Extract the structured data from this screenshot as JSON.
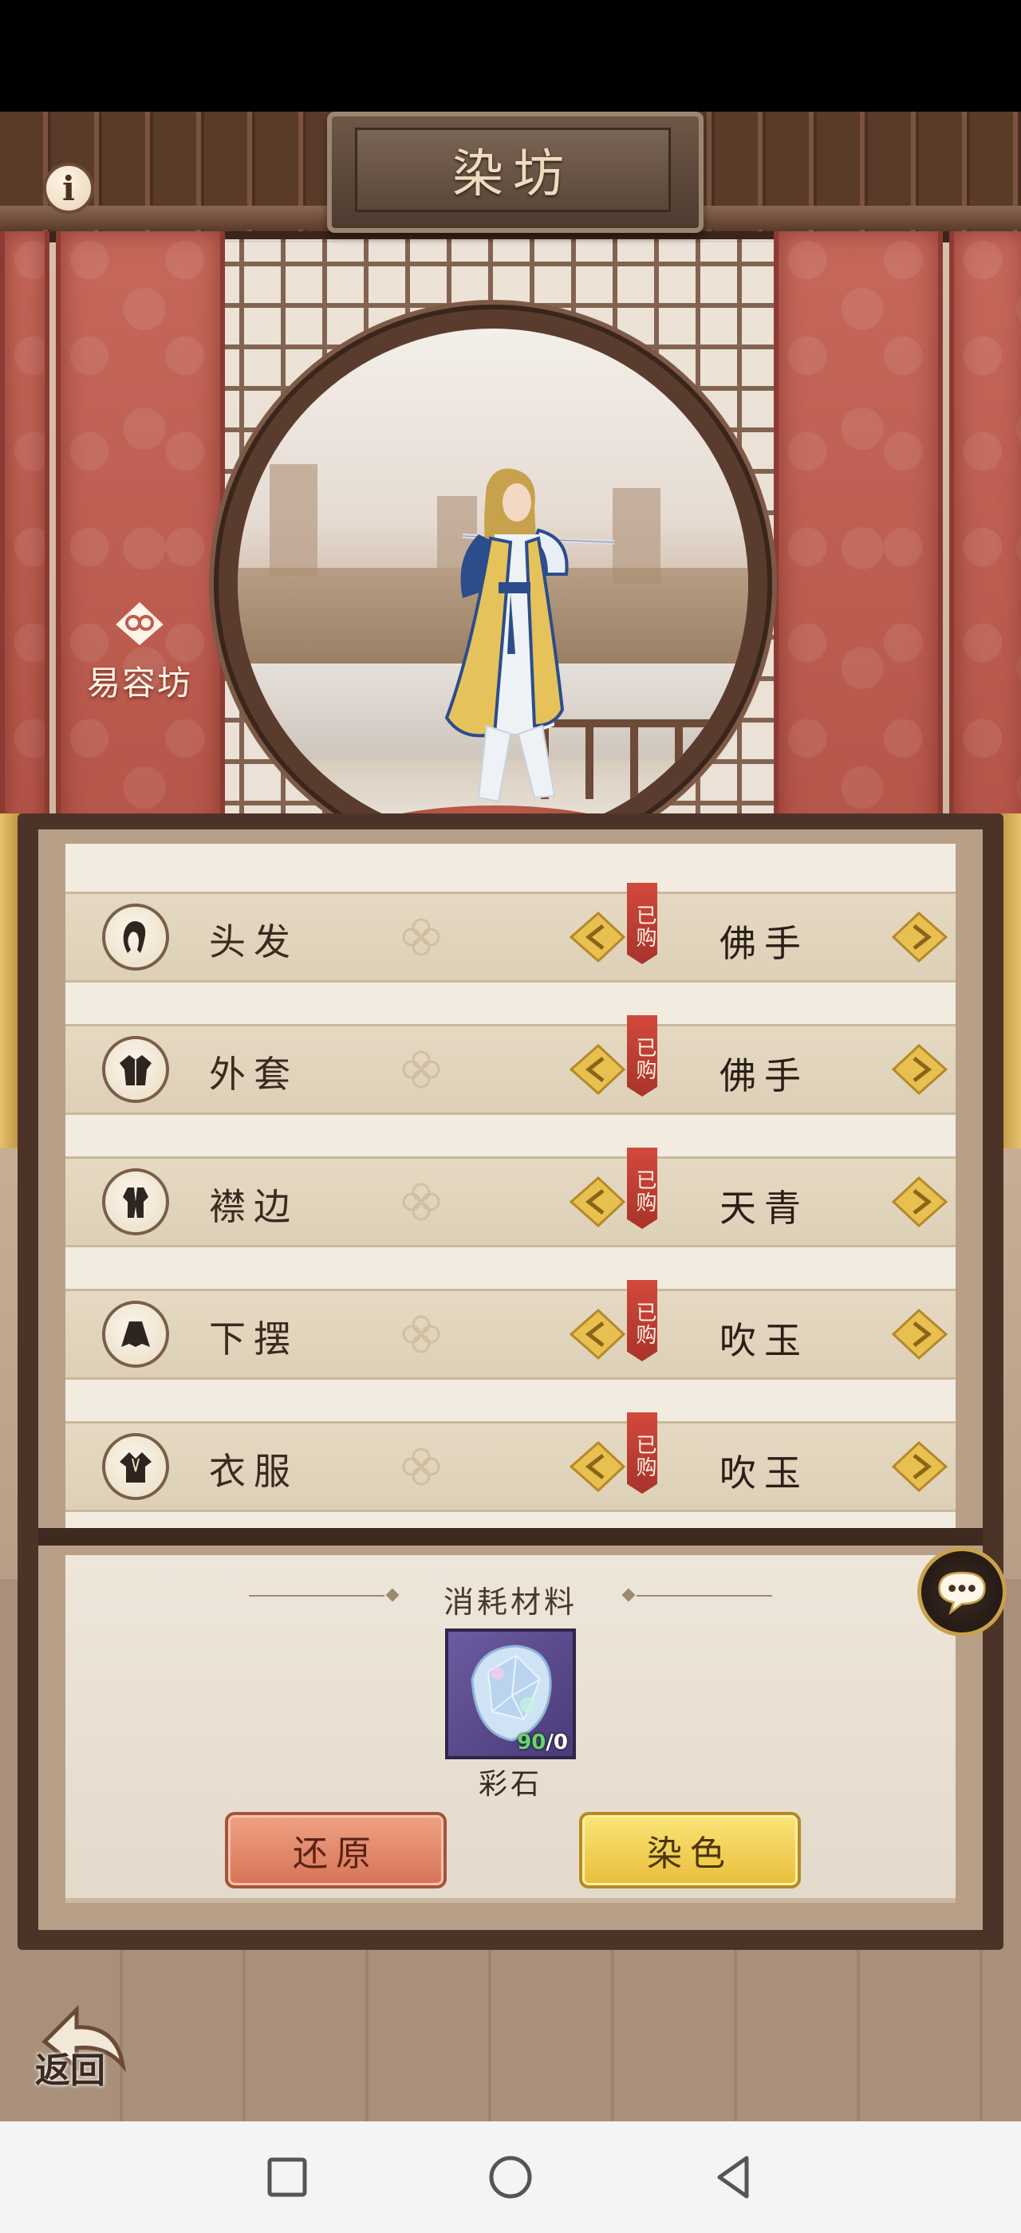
{
  "header": {
    "title": "染坊",
    "info_icon": "i"
  },
  "side_button": {
    "label": "易容坊"
  },
  "options": [
    {
      "slot": "头发",
      "icon": "hair-icon",
      "bought_tag": "已购",
      "color": "佛手"
    },
    {
      "slot": "外套",
      "icon": "coat-icon",
      "bought_tag": "已购",
      "color": "佛手"
    },
    {
      "slot": "襟边",
      "icon": "collar-icon",
      "bought_tag": "已购",
      "color": "天青"
    },
    {
      "slot": "下摆",
      "icon": "hem-icon",
      "bought_tag": "已购",
      "color": "吹玉"
    },
    {
      "slot": "衣服",
      "icon": "clothes-icon",
      "bought_tag": "已购",
      "color": "吹玉"
    }
  ],
  "materials": {
    "header": "消耗材料",
    "item": {
      "name": "彩石",
      "have": "90",
      "need": "0",
      "separator": "/"
    }
  },
  "buttons": {
    "restore": "还原",
    "dye": "染色",
    "back": "返回"
  },
  "colors": {
    "banner_red": "#b45448",
    "panel_brown": "#4b3327",
    "dye_button_gold": "#e9be3a",
    "restore_button_orange": "#d67356"
  }
}
